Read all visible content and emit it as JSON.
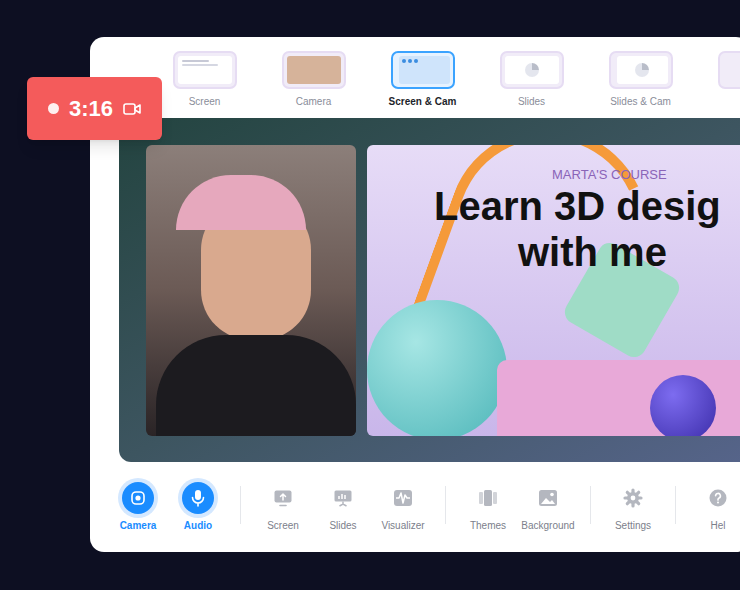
{
  "recording": {
    "time": "3:16"
  },
  "layouts": [
    {
      "label": "Screen",
      "kind": "screen",
      "selected": false
    },
    {
      "label": "Camera",
      "kind": "camera",
      "selected": false
    },
    {
      "label": "Screen & Cam",
      "kind": "screen-cam",
      "selected": true
    },
    {
      "label": "Slides",
      "kind": "slides",
      "selected": false
    },
    {
      "label": "Slides & Cam",
      "kind": "slides-cam",
      "selected": false
    }
  ],
  "slide": {
    "eyebrow": "MARTA'S COURSE",
    "title_lines": [
      "Learn 3D desig",
      "with me"
    ]
  },
  "toolbar": {
    "groups": [
      [
        {
          "label": "Camera",
          "kind": "camera",
          "on": true
        },
        {
          "label": "Audio",
          "kind": "audio",
          "on": true
        }
      ],
      [
        {
          "label": "Screen",
          "kind": "screen",
          "on": false
        },
        {
          "label": "Slides",
          "kind": "slides",
          "on": false
        },
        {
          "label": "Visualizer",
          "kind": "visualizer",
          "on": false
        }
      ],
      [
        {
          "label": "Themes",
          "kind": "themes",
          "on": false
        },
        {
          "label": "Background",
          "kind": "background",
          "on": false
        }
      ],
      [
        {
          "label": "Settings",
          "kind": "settings",
          "on": false
        }
      ],
      [
        {
          "label": "Hel",
          "kind": "help",
          "on": false
        }
      ]
    ]
  }
}
